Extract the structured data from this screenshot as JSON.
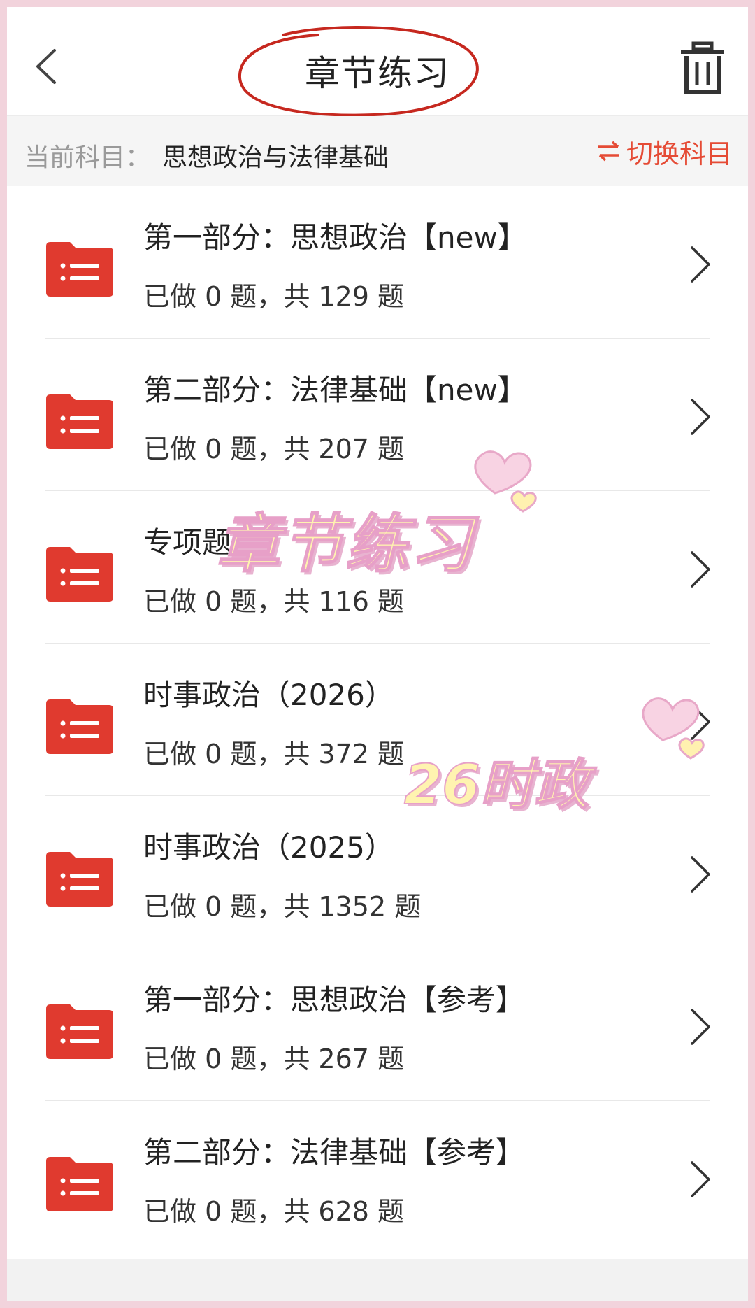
{
  "header": {
    "title": "章节练习"
  },
  "subject_bar": {
    "label": "当前科目：",
    "value": "思想政治与法律基础",
    "switch_label": "切换科目"
  },
  "chapters": [
    {
      "title": "第一部分：思想政治【new】",
      "count": "已做 0 题，共 129 题"
    },
    {
      "title": "第二部分：法律基础【new】",
      "count": "已做 0 题，共 207 题"
    },
    {
      "title": "专项题",
      "count": "已做 0 题，共 116 题"
    },
    {
      "title": "时事政治（2026）",
      "count": "已做 0 题，共 372 题"
    },
    {
      "title": "时事政治（2025）",
      "count": "已做 0 题，共 1352 题"
    },
    {
      "title": "第一部分：思想政治【参考】",
      "count": "已做 0 题，共 267 题"
    },
    {
      "title": "第二部分：法律基础【参考】",
      "count": "已做 0 题，共 628 题"
    }
  ],
  "stickers": {
    "sticker1": "章节练习",
    "sticker2": "26时政"
  },
  "colors": {
    "accent": "#e54b35",
    "folder": "#e03a2f",
    "frame": "#f2d3dc"
  },
  "icons": {
    "back": "chevron-left-icon",
    "trash": "trash-icon",
    "switch": "swap-arrows-icon",
    "folder": "folder-list-icon",
    "item_arrow": "chevron-right-icon"
  }
}
